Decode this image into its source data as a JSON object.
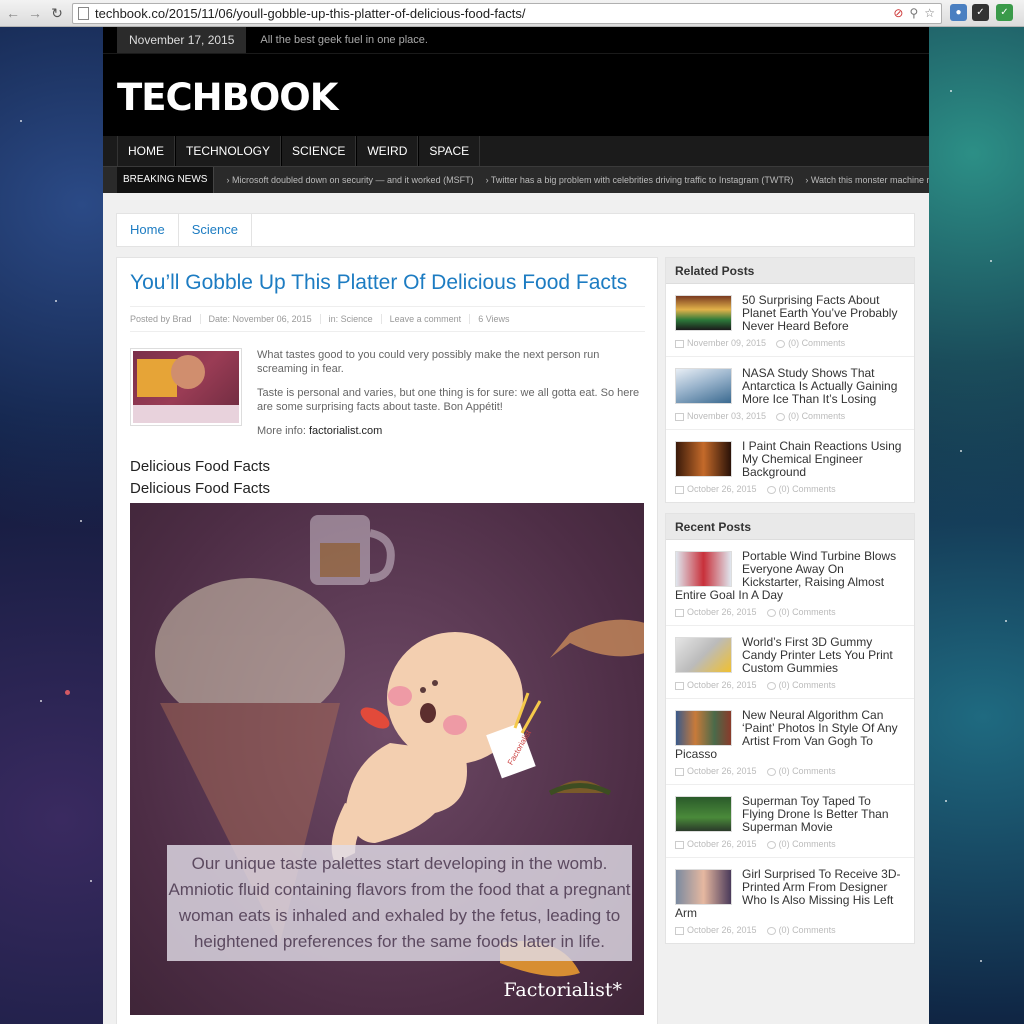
{
  "browser": {
    "url": "techbook.co/2015/11/06/youll-gobble-up-this-platter-of-delicious-food-facts/",
    "back_icon": "arrow-left",
    "forward_icon": "arrow-right",
    "reload_icon": "reload"
  },
  "topbar": {
    "date": "November 17, 2015",
    "tagline": "All the best geek fuel in one place."
  },
  "site": {
    "logo": "TECHBOOK"
  },
  "nav": [
    "HOME",
    "TECHNOLOGY",
    "SCIENCE",
    "WEIRD",
    "SPACE"
  ],
  "breaking": {
    "label": "BREAKING NEWS",
    "items": [
      "› Microsoft doubled down on security — and it worked (MSFT)",
      "› Twitter has a big problem with celebrities driving traffic to Instagram (TWTR)",
      "› Watch this monster machine rip tre"
    ]
  },
  "breadcrumb": [
    "Home",
    "Science"
  ],
  "article": {
    "title": "You’ll Gobble Up This Platter Of Delicious Food Facts",
    "meta": [
      "Posted by Brad",
      "Date: November 06, 2015",
      "in: Science",
      "Leave a comment",
      "6 Views"
    ],
    "intro1": "What tastes good to you could very possibly make the next person run screaming in fear.",
    "intro2": "Taste is personal and varies, but one thing is for sure: we all gotta eat. So here are some surprising facts about taste. Bon Appétit!",
    "more_label": "More info:",
    "more_link": "factorialist.com",
    "heading1": "Delicious Food Facts",
    "heading2": "Delicious Food Facts",
    "caption": "Our unique taste palettes start developing in the womb. Amniotic fluid containing flavors from the food that a pregnant woman eats is inhaled and exhaled by the fetus, leading to heightened preferences for the same foods later in life.",
    "brand": "Factorialist*",
    "box_label": "Factorialist"
  },
  "related": {
    "heading": "Related Posts",
    "posts": [
      {
        "title": "50 Surprising Facts About Planet Earth You’ve Probably Never Heard Before",
        "date": "November 09, 2015",
        "comments": "(0) Comments"
      },
      {
        "title": "NASA Study Shows That Antarctica Is Actually Gaining More Ice Than It’s Losing",
        "date": "November 03, 2015",
        "comments": "(0) Comments"
      },
      {
        "title": "I Paint Chain Reactions Using My Chemical Engineer Background",
        "date": "October 26, 2015",
        "comments": "(0) Comments"
      }
    ]
  },
  "recent": {
    "heading": "Recent Posts",
    "posts": [
      {
        "title": "Portable Wind Turbine Blows Everyone Away On Kickstarter, Raising Almost Entire Goal In A Day",
        "date": "October 26, 2015",
        "comments": "(0) Comments"
      },
      {
        "title": "World’s First 3D Gummy Candy Printer Lets You Print Custom Gummies",
        "date": "October 26, 2015",
        "comments": "(0) Comments"
      },
      {
        "title": "New Neural Algorithm Can ‘Paint’ Photos In Style Of Any Artist From Van Gogh To Picasso",
        "date": "October 26, 2015",
        "comments": "(0) Comments"
      },
      {
        "title": "Superman Toy Taped To Flying Drone Is Better Than Superman Movie",
        "date": "October 26, 2015",
        "comments": "(0) Comments"
      },
      {
        "title": "Girl Surprised To Receive 3D-Printed Arm From Designer Who Is Also Missing His Left Arm",
        "date": "October 26, 2015",
        "comments": "(0) Comments"
      }
    ]
  },
  "colors": {
    "accent": "#1d7cc2",
    "header_bg": "#000000",
    "nav_bg": "#1b1b1b"
  }
}
